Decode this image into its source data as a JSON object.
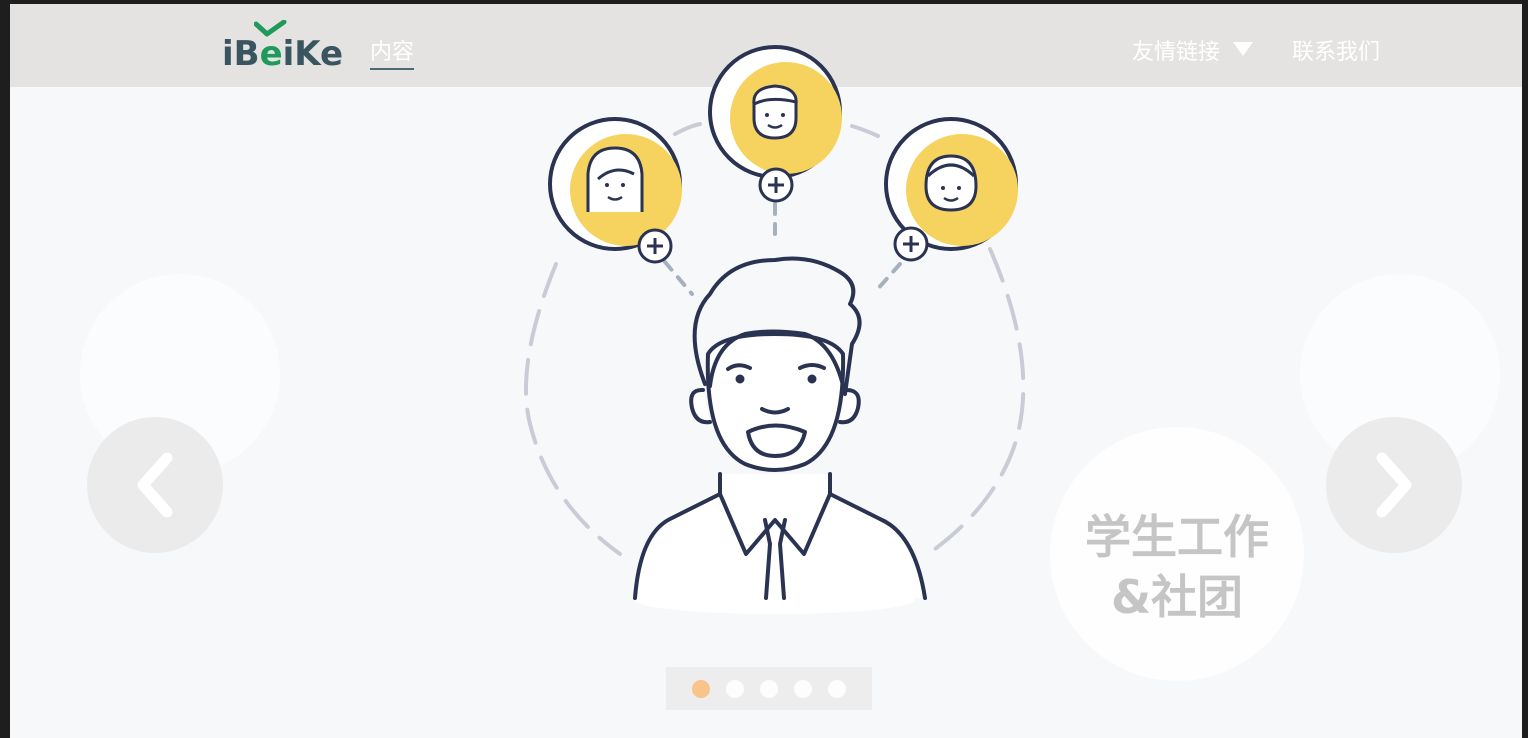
{
  "nav": {
    "logo_text_1": "iB",
    "logo_text_e": "e",
    "logo_text_2": "iKe",
    "content_tab": "内容",
    "links_menu": "友情链接",
    "contact": "联系我们"
  },
  "carousel": {
    "caption_line1": "学生工作",
    "caption_line2": "&社团",
    "slide_count": 5,
    "active_slide": 1
  },
  "colors": {
    "accent_yellow": "#f5d35e",
    "line_navy": "#2b3352",
    "brand_green": "#1f9a5b",
    "active_dot": "#f8c489"
  }
}
